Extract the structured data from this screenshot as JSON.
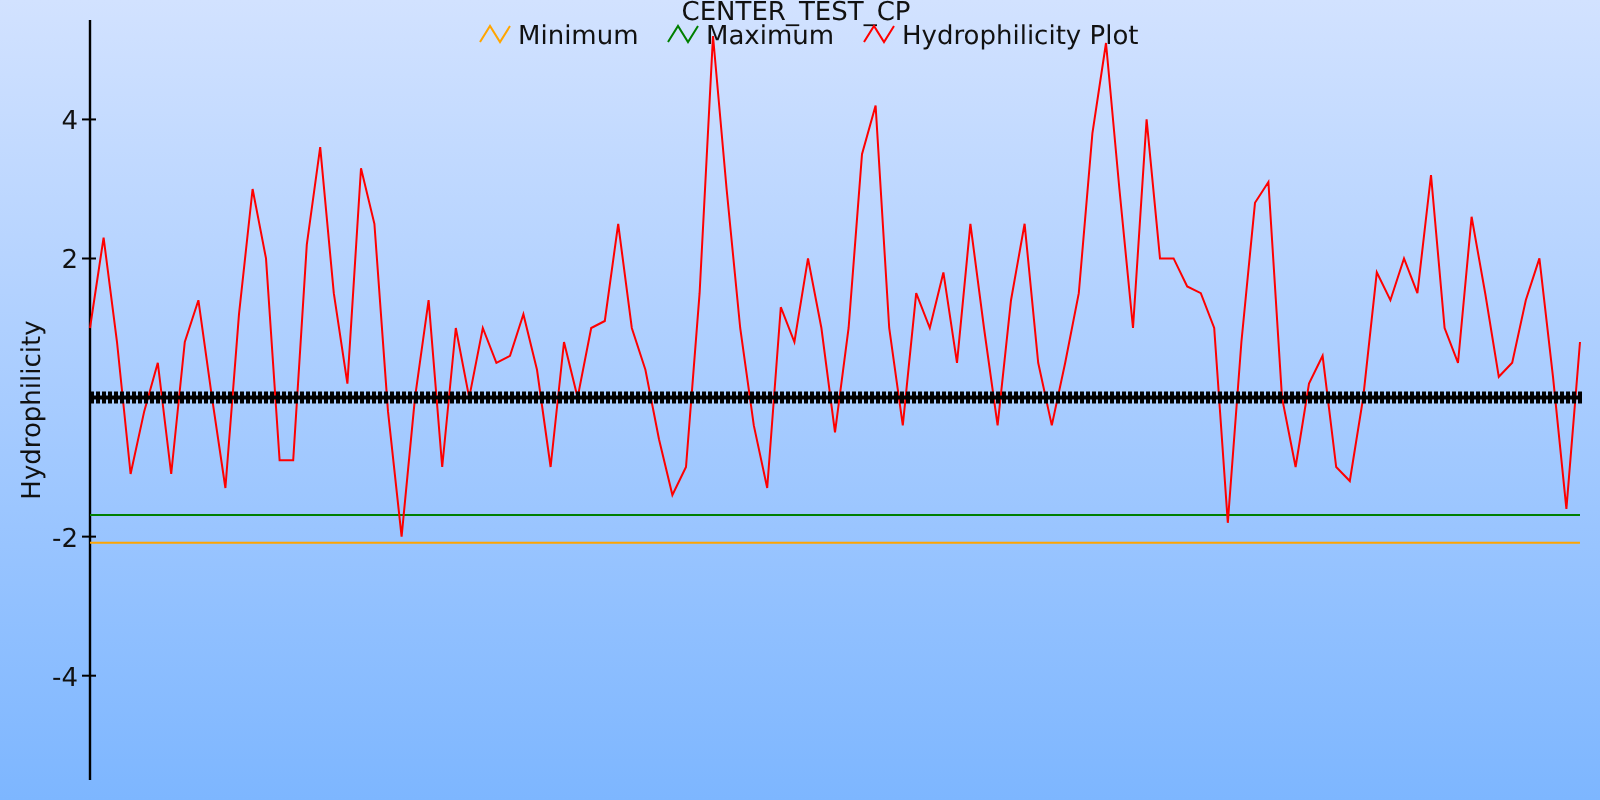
{
  "chart": {
    "chart_data": {
      "type": "line",
      "legend": "top",
      "title": "CENTER_TEST_CP",
      "ylabel": "Hydrophilicity",
      "ylim": [
        -5.5,
        5.43
      ],
      "yticks": [
        -4,
        -2,
        2,
        4
      ],
      "series": [
        {
          "name": "Minimum",
          "color": "#ffa500",
          "values": [
            -2.09,
            -2.09,
            -2.09,
            -2.09,
            -2.09,
            -2.09,
            -2.09,
            -2.09,
            -2.09,
            -2.09,
            -2.09,
            -2.09,
            -2.09,
            -2.09,
            -2.09,
            -2.09,
            -2.09,
            -2.09,
            -2.09,
            -2.09,
            -2.09,
            -2.09,
            -2.09,
            -2.09,
            -2.09,
            -2.09,
            -2.09,
            -2.09,
            -2.09,
            -2.09,
            -2.09,
            -2.09,
            -2.09,
            -2.09,
            -2.09,
            -2.09,
            -2.09,
            -2.09,
            -2.09,
            -2.09,
            -2.09,
            -2.09,
            -2.09,
            -2.09,
            -2.09,
            -2.09,
            -2.09,
            -2.09,
            -2.09,
            -2.09,
            -2.09,
            -2.09,
            -2.09,
            -2.09,
            -2.09,
            -2.09,
            -2.09,
            -2.09,
            -2.09,
            -2.09,
            -2.09,
            -2.09,
            -2.09,
            -2.09,
            -2.09,
            -2.09,
            -2.09,
            -2.09,
            -2.09,
            -2.09,
            -2.09,
            -2.09,
            -2.09,
            -2.09,
            -2.09,
            -2.09,
            -2.09,
            -2.09,
            -2.09,
            -2.09,
            -2.09,
            -2.09,
            -2.09,
            -2.09,
            -2.09,
            -2.09,
            -2.09,
            -2.09,
            -2.09,
            -2.09,
            -2.09,
            -2.09,
            -2.09,
            -2.09,
            -2.09,
            -2.09,
            -2.09,
            -2.09,
            -2.09,
            -2.09,
            -2.09,
            -2.09,
            -2.09,
            -2.09,
            -2.09,
            -2.09,
            -2.09,
            -2.09,
            -2.09,
            -2.09,
            -2.09
          ]
        },
        {
          "name": "Maximum",
          "color": "#007f00",
          "values": [
            -1.69,
            -1.69,
            -1.69,
            -1.69,
            -1.69,
            -1.69,
            -1.69,
            -1.69,
            -1.69,
            -1.69,
            -1.69,
            -1.69,
            -1.69,
            -1.69,
            -1.69,
            -1.69,
            -1.69,
            -1.69,
            -1.69,
            -1.69,
            -1.69,
            -1.69,
            -1.69,
            -1.69,
            -1.69,
            -1.69,
            -1.69,
            -1.69,
            -1.69,
            -1.69,
            -1.69,
            -1.69,
            -1.69,
            -1.69,
            -1.69,
            -1.69,
            -1.69,
            -1.69,
            -1.69,
            -1.69,
            -1.69,
            -1.69,
            -1.69,
            -1.69,
            -1.69,
            -1.69,
            -1.69,
            -1.69,
            -1.69,
            -1.69,
            -1.69,
            -1.69,
            -1.69,
            -1.69,
            -1.69,
            -1.69,
            -1.69,
            -1.69,
            -1.69,
            -1.69,
            -1.69,
            -1.69,
            -1.69,
            -1.69,
            -1.69,
            -1.69,
            -1.69,
            -1.69,
            -1.69,
            -1.69,
            -1.69,
            -1.69,
            -1.69,
            -1.69,
            -1.69,
            -1.69,
            -1.69,
            -1.69,
            -1.69,
            -1.69,
            -1.69,
            -1.69,
            -1.69,
            -1.69,
            -1.69,
            -1.69,
            -1.69,
            -1.69,
            -1.69,
            -1.69,
            -1.69,
            -1.69,
            -1.69,
            -1.69,
            -1.69,
            -1.69,
            -1.69,
            -1.69,
            -1.69,
            -1.69,
            -1.69,
            -1.69,
            -1.69,
            -1.69,
            -1.69,
            -1.69,
            -1.69,
            -1.69,
            -1.69,
            -1.69,
            -1.69
          ]
        },
        {
          "name": "Hydrophilicity Plot",
          "color": "#ff0000",
          "values": [
            1,
            2.3,
            0.8,
            -1.1,
            -0.2,
            0.5,
            -1.1,
            0.8,
            1.4,
            0,
            -1.3,
            1.2,
            3.0,
            2.0,
            -0.9,
            -0.9,
            2.2,
            3.6,
            1.5,
            0.2,
            3.3,
            2.5,
            -0.2,
            -2.0,
            0,
            1.4,
            -1.0,
            1.0,
            0,
            1.0,
            0.5,
            0.6,
            1.2,
            0.4,
            -1.0,
            0.8,
            0.0,
            1.0,
            1.1,
            2.5,
            1.0,
            0.4,
            -0.6,
            -1.4,
            -1.0,
            1.5,
            5.2,
            3.0,
            1.0,
            -0.4,
            -1.3,
            1.3,
            0.8,
            2.0,
            1.0,
            -0.5,
            1.0,
            3.5,
            4.2,
            1.0,
            -0.4,
            1.5,
            1.0,
            1.8,
            0.5,
            2.5,
            1.0,
            -0.4,
            1.4,
            2.5,
            0.5,
            -0.4,
            0.5,
            1.5,
            3.8,
            5.1,
            3.0,
            1.0,
            4.0,
            2.0,
            2.0,
            1.6,
            1.5,
            1.0,
            -1.8,
            0.8,
            2.8,
            3.1,
            0,
            -1.0,
            0.2,
            0.6,
            -1.0,
            -1.2,
            0,
            1.8,
            1.4,
            2.0,
            1.5,
            3.2,
            1.0,
            0.5,
            2.6,
            1.5,
            0.3,
            0.5,
            1.4,
            2.0,
            0.3,
            -1.6,
            0.8
          ]
        }
      ]
    }
  }
}
